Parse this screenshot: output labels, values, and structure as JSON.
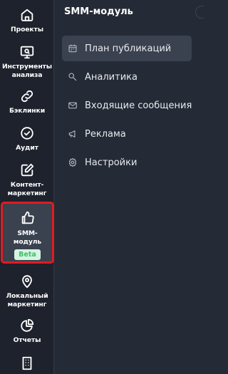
{
  "sidebar": {
    "items": [
      {
        "label": "Проекты",
        "icon": "home-icon"
      },
      {
        "label": "Инструменты\nанализа",
        "icon": "monitor-icon"
      },
      {
        "label": "Бэклинки",
        "icon": "link-icon"
      },
      {
        "label": "Аудит",
        "icon": "check-circle-icon"
      },
      {
        "label": "Контент-\nмаркетинг",
        "icon": "edit-icon"
      },
      {
        "label": "SMM-\nмодуль",
        "icon": "thumbs-up-icon",
        "badge": "Beta"
      },
      {
        "label": "Локальный\nмаркетинг",
        "icon": "map-pin-icon"
      },
      {
        "label": "Отчеты",
        "icon": "pie-chart-icon"
      },
      {
        "label": "",
        "icon": "building-icon"
      }
    ]
  },
  "panel": {
    "title": "SMM-модуль",
    "menu": [
      {
        "label": "План публикаций",
        "icon": "calendar-icon"
      },
      {
        "label": "Аналитика",
        "icon": "search-icon"
      },
      {
        "label": "Входящие сообщения",
        "icon": "mail-icon"
      },
      {
        "label": "Реклама",
        "icon": "megaphone-icon"
      },
      {
        "label": "Настройки",
        "icon": "gear-icon"
      }
    ]
  },
  "colors": {
    "rail_bg": "#1d222c",
    "panel_bg": "#252b36",
    "selected_bg": "#3a414f",
    "highlight_border": "#e11b22",
    "beta_text": "#3fbf6a",
    "beta_bg": "#d8f3e1"
  }
}
